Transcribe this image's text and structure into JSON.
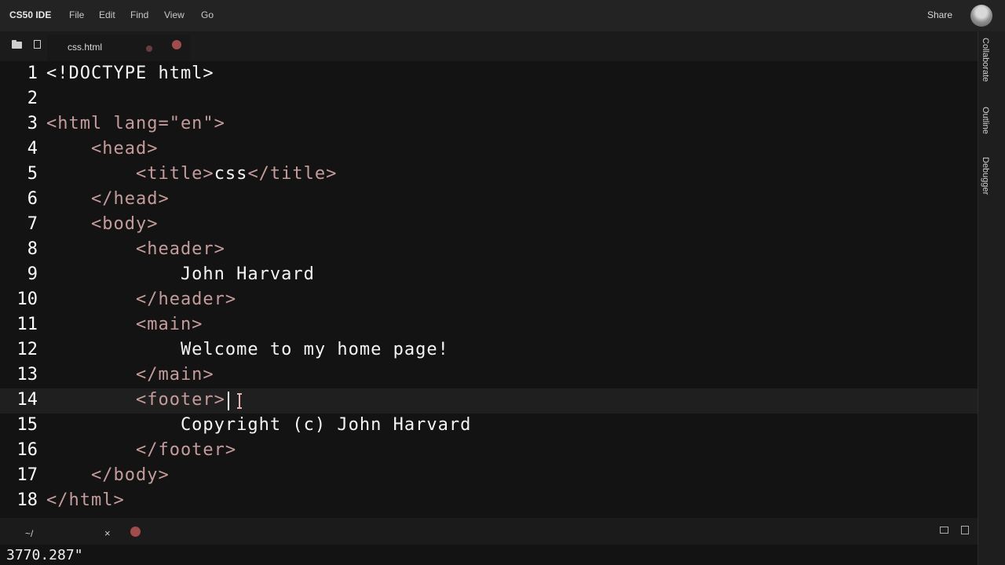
{
  "app": {
    "brand": "CS50 IDE"
  },
  "menu": {
    "items": [
      "File",
      "Edit",
      "Find",
      "View",
      "Go"
    ]
  },
  "header": {
    "share_label": "Share"
  },
  "tab": {
    "label": "css.html"
  },
  "editor": {
    "lines": [
      {
        "num": "1",
        "tokens": [
          {
            "t": "<!DOCTYPE html>",
            "c": "txt"
          }
        ]
      },
      {
        "num": "2",
        "tokens": []
      },
      {
        "num": "3",
        "tokens": [
          {
            "t": "<html lang=\"en\">",
            "c": "tag"
          }
        ]
      },
      {
        "num": "4",
        "tokens": [
          {
            "t": "    <head>",
            "c": "tag"
          }
        ]
      },
      {
        "num": "5",
        "tokens": [
          {
            "t": "        <title>",
            "c": "tag"
          },
          {
            "t": "css",
            "c": "txt"
          },
          {
            "t": "</title>",
            "c": "tag"
          }
        ]
      },
      {
        "num": "6",
        "tokens": [
          {
            "t": "    </head>",
            "c": "tag"
          }
        ]
      },
      {
        "num": "7",
        "tokens": [
          {
            "t": "    <body>",
            "c": "tag"
          }
        ]
      },
      {
        "num": "8",
        "tokens": [
          {
            "t": "        <header>",
            "c": "tag"
          }
        ]
      },
      {
        "num": "9",
        "tokens": [
          {
            "t": "            John Harvard",
            "c": "txt"
          }
        ]
      },
      {
        "num": "10",
        "tokens": [
          {
            "t": "        </header>",
            "c": "tag"
          }
        ]
      },
      {
        "num": "11",
        "tokens": [
          {
            "t": "        <main>",
            "c": "tag"
          }
        ]
      },
      {
        "num": "12",
        "tokens": [
          {
            "t": "            Welcome to my home page!",
            "c": "txt"
          }
        ]
      },
      {
        "num": "13",
        "tokens": [
          {
            "t": "        </main>",
            "c": "tag"
          }
        ]
      },
      {
        "num": "14",
        "tokens": [
          {
            "t": "        <footer>",
            "c": "tag"
          }
        ]
      },
      {
        "num": "15",
        "tokens": [
          {
            "t": "            Copyright (c) John Harvard",
            "c": "txt"
          }
        ]
      },
      {
        "num": "16",
        "tokens": [
          {
            "t": "        </footer>",
            "c": "tag"
          }
        ]
      },
      {
        "num": "17",
        "tokens": [
          {
            "t": "    </body>",
            "c": "tag"
          }
        ]
      },
      {
        "num": "18",
        "tokens": [
          {
            "t": "</html>",
            "c": "tag"
          }
        ]
      }
    ],
    "active_line": 14
  },
  "right_panel": {
    "tabs": [
      "Collaborate",
      "Outline",
      "Debugger"
    ]
  },
  "terminal": {
    "tab_label": "~/",
    "close_label": "×",
    "output": "3770.287\""
  },
  "colors": {
    "tag": "#c59c9c",
    "text": "#f4f4f4",
    "accent": "#a04c4c"
  }
}
